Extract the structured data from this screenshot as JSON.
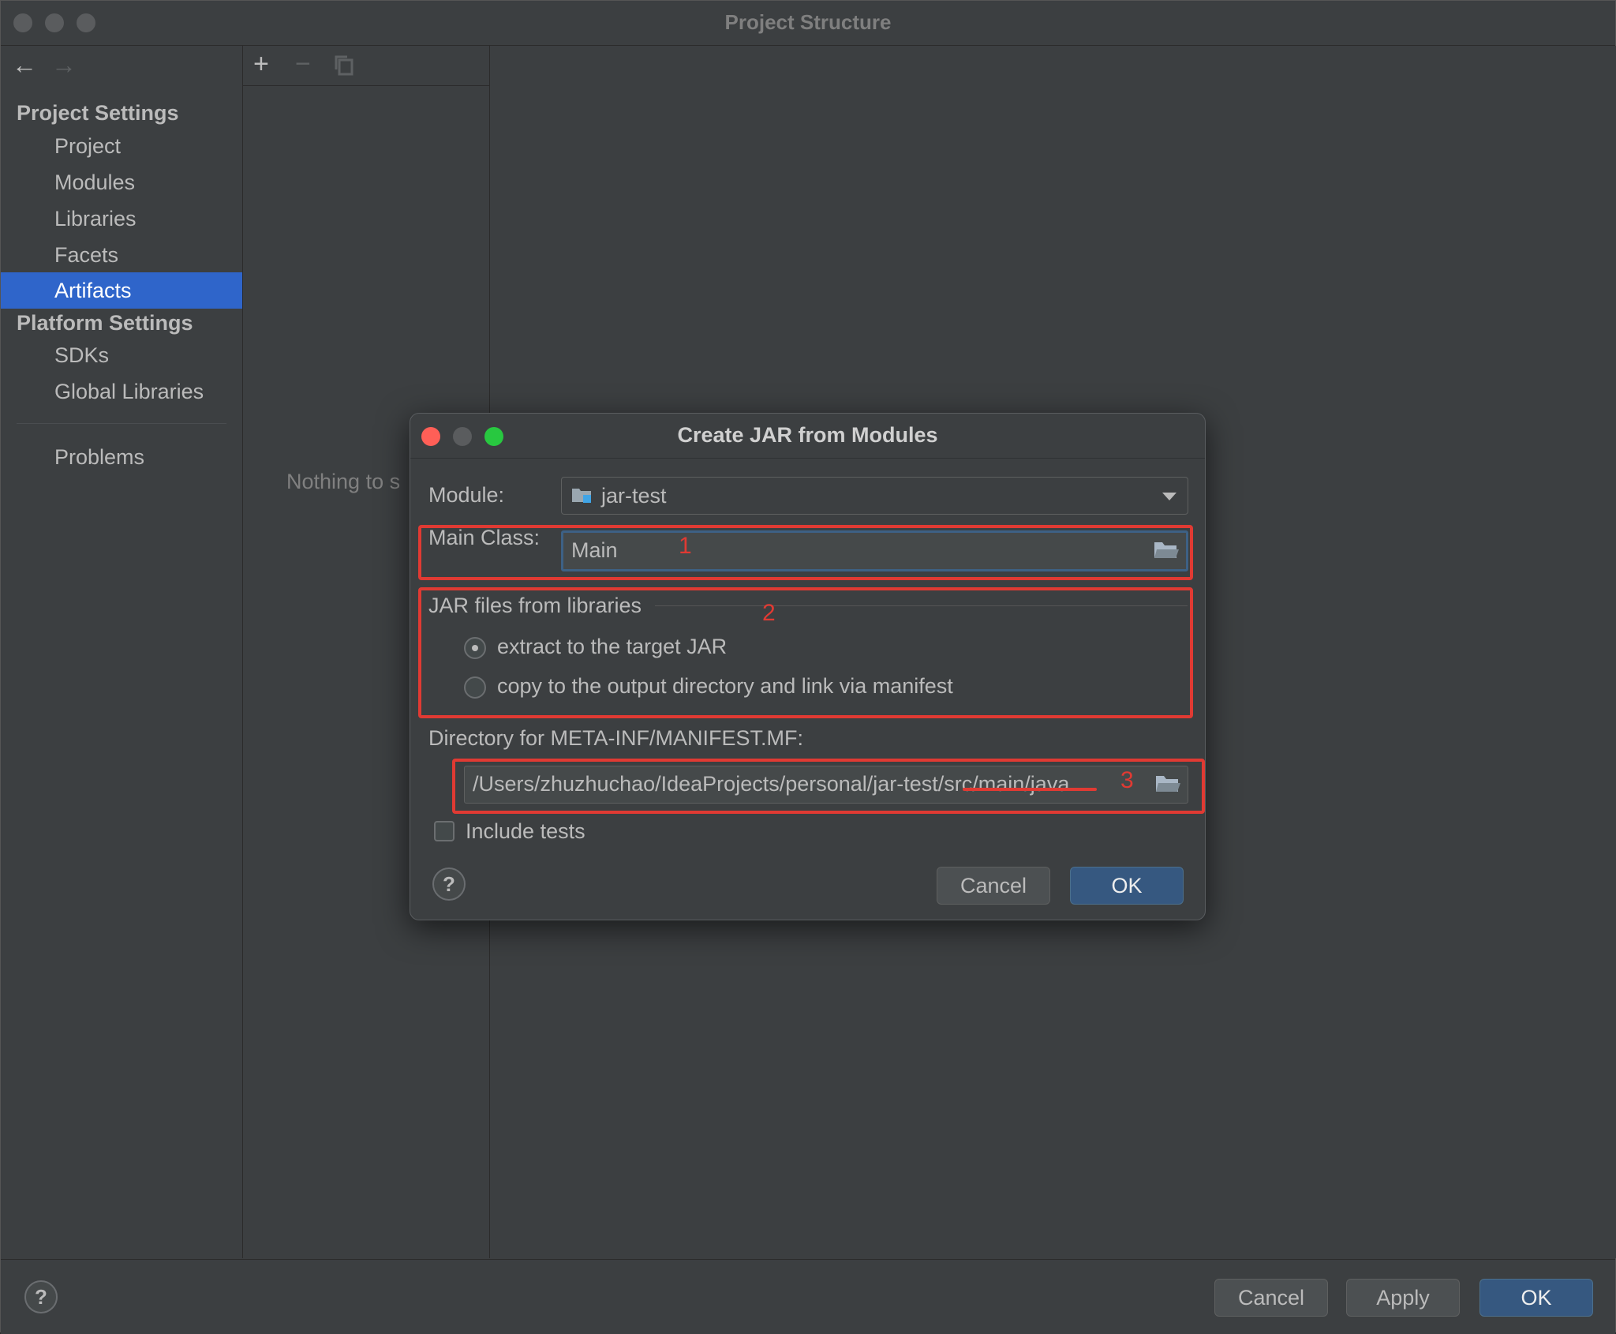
{
  "window": {
    "title": "Project Structure"
  },
  "sidebar": {
    "project_settings_title": "Project Settings",
    "platform_settings_title": "Platform Settings",
    "project_items": [
      "Project",
      "Modules",
      "Libraries",
      "Facets",
      "Artifacts"
    ],
    "platform_items": [
      "SDKs",
      "Global Libraries"
    ],
    "problems": "Problems",
    "selected": "Artifacts"
  },
  "middle": {
    "empty_text": "Nothing to s"
  },
  "footer": {
    "help": "?",
    "cancel_label": "Cancel",
    "apply_label": "Apply",
    "ok_label": "OK"
  },
  "dialog": {
    "title": "Create JAR from Modules",
    "module_label": "Module:",
    "module_value": "jar-test",
    "main_class_label": "Main Class:",
    "main_class_value": "Main",
    "jar_group_label": "JAR files from libraries",
    "radio_extract": "extract to the target JAR",
    "radio_copy": "copy to the output directory and link via manifest",
    "radio_selected": "extract",
    "manifest_label": "Directory for META-INF/MANIFEST.MF:",
    "manifest_value": "/Users/zhuzhuchao/IdeaProjects/personal/jar-test/src/main/java",
    "include_tests_label": "Include tests",
    "include_tests_checked": false,
    "help": "?",
    "cancel_label": "Cancel",
    "ok_label": "OK",
    "annotations": [
      "1",
      "2",
      "3"
    ]
  },
  "colors": {
    "accent": "#2f65ca",
    "primary_button": "#365880",
    "annotation": "#e03a33",
    "close": "#ff5f57",
    "minimize": "#5a5c5e",
    "maximize": "#28c840"
  }
}
